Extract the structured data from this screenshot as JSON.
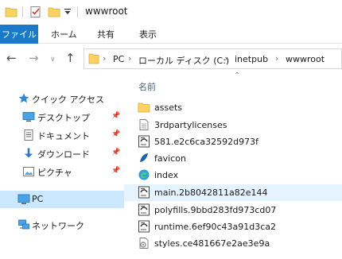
{
  "window": {
    "title": "wwwroot"
  },
  "ribbon": {
    "file_tab": "ファイル",
    "tabs": [
      "ホーム",
      "共有",
      "表示"
    ]
  },
  "address": {
    "crumbs": [
      "PC",
      "ローカル ディスク (C:)",
      "inetpub",
      "wwwroot"
    ]
  },
  "nav_pane": {
    "quick_access": "クイック アクセス",
    "items": [
      "デスクトップ",
      "ドキュメント",
      "ダウンロード",
      "ピクチャ"
    ],
    "pc": "PC",
    "network": "ネットワーク"
  },
  "file_list": {
    "column_name": "名前",
    "files": [
      {
        "name": "assets",
        "icon": "folder-icon"
      },
      {
        "name": "3rdpartylicenses",
        "icon": "text-file-icon"
      },
      {
        "name": "581.e2c6ca32592d973f",
        "icon": "script-file-icon"
      },
      {
        "name": "favicon",
        "icon": "favicon-icon"
      },
      {
        "name": "index",
        "icon": "edge-html-icon"
      },
      {
        "name": "main.2b8042811a82e144",
        "icon": "script-file-icon"
      },
      {
        "name": "polyfills.9bbd283fd973cd07",
        "icon": "script-file-icon"
      },
      {
        "name": "runtime.6ef90c43a91d3ca2",
        "icon": "script-file-icon"
      },
      {
        "name": "styles.ce481667e2ae3e9a",
        "icon": "css-file-icon"
      }
    ]
  },
  "colors": {
    "accent": "#1979ca",
    "selection": "#cce8ff",
    "hover": "#e5f3ff",
    "folder": "#ffd25f"
  }
}
